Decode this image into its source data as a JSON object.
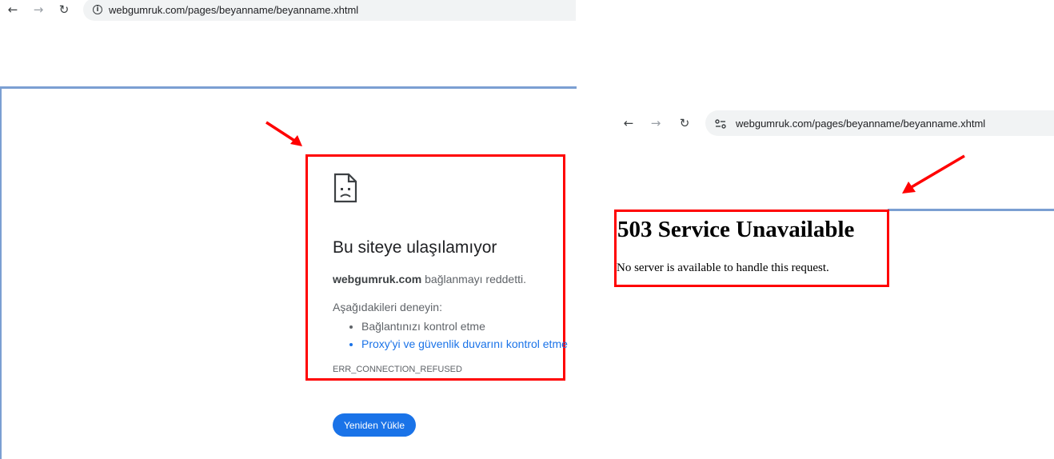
{
  "left_browser": {
    "url": "webgumruk.com/pages/beyanname/beyanname.xhtml",
    "error": {
      "title": "Bu siteye ulaşılamıyor",
      "host": "webgumruk.com",
      "host_message": " bağlanmayı reddetti.",
      "try_label": "Aşağıdakileri deneyin:",
      "suggestions": [
        "Bağlantınızı kontrol etme",
        "Proxy'yi ve güvenlik duvarını kontrol etme"
      ],
      "code": "ERR_CONNECTION_REFUSED"
    },
    "reload_label": "Yeniden Yükle"
  },
  "right_browser": {
    "url": "webgumruk.com/pages/beyanname/beyanname.xhtml",
    "title": "503 Service Unavailable",
    "message": "No server is available to handle this request."
  },
  "icons": {
    "back": "back-arrow-icon",
    "forward": "forward-arrow-icon",
    "reload": "reload-icon",
    "info": "info-icon",
    "site_settings": "tune-icon",
    "error_page": "sad-page-icon"
  },
  "colors": {
    "highlight": "#ff0000",
    "link": "#1a73e8",
    "button": "#1a73e8",
    "pane_border": "#7b9fd2"
  }
}
